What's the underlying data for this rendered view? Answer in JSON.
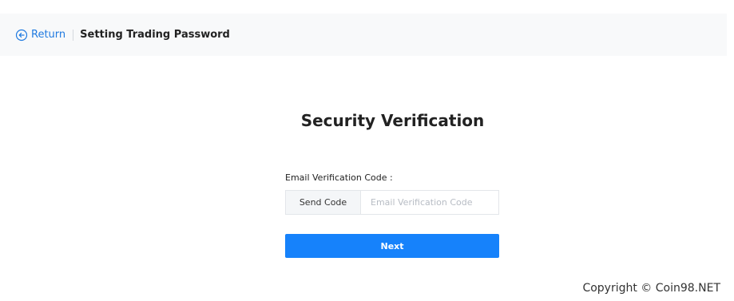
{
  "header": {
    "return_label": "Return",
    "title": "Setting Trading Password",
    "accent_color": "#1f7ae0",
    "return_icon": "arrow-left-circle-icon"
  },
  "verification": {
    "title": "Security Verification",
    "email_label": "Email Verification Code :",
    "send_code_label": "Send Code",
    "email_placeholder": "Email Verification Code",
    "email_value": "",
    "next_label": "Next",
    "button_color": "#1682fb"
  },
  "footer": {
    "copyright": "Copyright © Coin98.NET"
  }
}
